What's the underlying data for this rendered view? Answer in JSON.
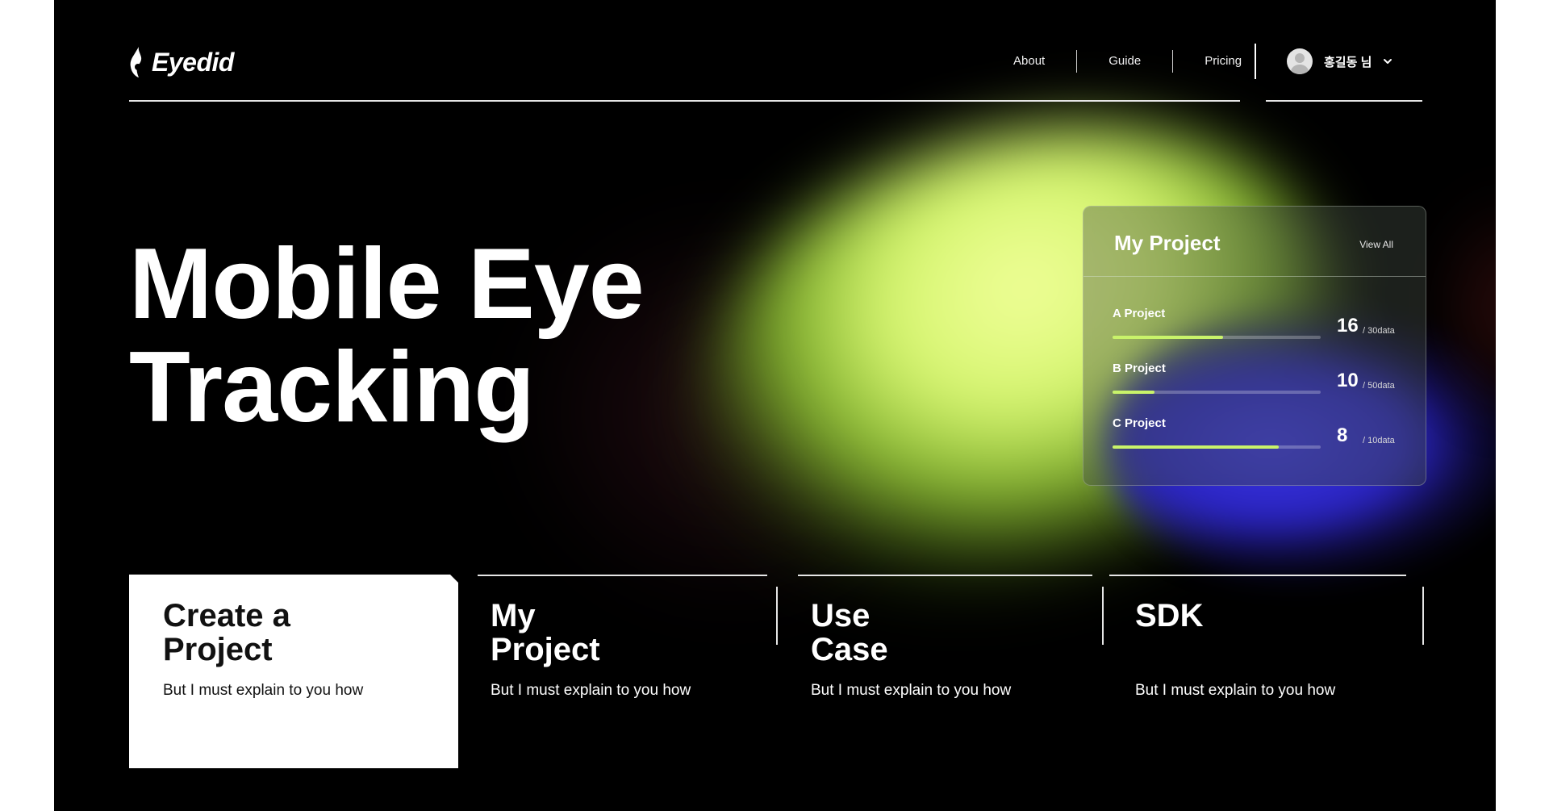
{
  "brand": {
    "name": "Eyedid",
    "icon": "eye-flame-logo-icon"
  },
  "nav": {
    "items": [
      "About",
      "Guide",
      "Pricing"
    ],
    "user": {
      "name": "홍길동 님",
      "avatar_icon": "avatar-icon",
      "dropdown_icon": "chevron-down-icon"
    }
  },
  "hero": {
    "line1": "Mobile Eye",
    "line2": "Tracking"
  },
  "project_card": {
    "title": "My Project",
    "view_all": "View All",
    "projects": [
      {
        "name": "A Project",
        "count": "16",
        "total": "/ 30data",
        "progress": 0.53
      },
      {
        "name": "B Project",
        "count": "10",
        "total": "/ 50data",
        "progress": 0.2
      },
      {
        "name": "C Project",
        "count": "8",
        "total": "/ 10data",
        "progress": 0.8
      }
    ],
    "progress_color": "#c9f36a"
  },
  "tiles": [
    {
      "line1": "Create a",
      "line2": "Project",
      "desc": "But I must explain to you how",
      "active": true
    },
    {
      "line1": "My",
      "line2": "Project",
      "desc": "But I must explain to you how",
      "active": false
    },
    {
      "line1": "Use",
      "line2": "Case",
      "desc": "But I must explain to you how",
      "active": false
    },
    {
      "line1": "SDK",
      "line2": "",
      "desc": "But I must explain to you how",
      "active": false
    }
  ],
  "colors": {
    "background": "#000000",
    "accent_green": "#d5f56f",
    "accent_blue": "#3b35e6"
  }
}
